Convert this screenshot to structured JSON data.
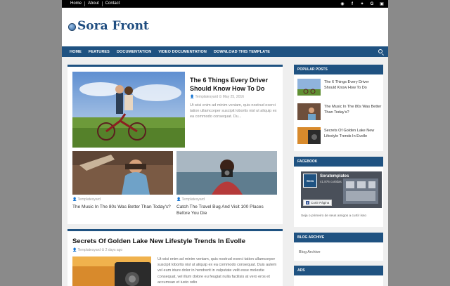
{
  "topbar": {
    "links": [
      "Home",
      "About",
      "Contact"
    ],
    "social_icons": [
      "rss-icon",
      "facebook-icon",
      "twitter-icon",
      "google-plus-icon",
      "instagram-icon"
    ]
  },
  "header": {
    "site_title": "Sora Front"
  },
  "nav": {
    "items": [
      "HOME",
      "FEATURES",
      "DOCUMENTATION",
      "VIDEO DOCUMENTATION",
      "DOWNLOAD THIS TEMPLATE"
    ]
  },
  "featured": {
    "title": "The 6 Things Every Driver Should Know How To Do",
    "author": "Templatesyard",
    "date": "May 25, 2016",
    "excerpt": "Ut wisi enim ad minim veniam, quis nostrud exerci tation ullamcorper suscipit lobortis nisl ut aliquip ex ea commodo consequat. Du..."
  },
  "small_posts": [
    {
      "author": "Templatesyard",
      "title": "The Music In The 80s Was Better Than Today's?"
    },
    {
      "author": "Templatesyard",
      "title": "Catch The Travel Bug And Visit 100 Places Before You Die"
    }
  ],
  "post2": {
    "title": "Secrets Of Golden Lake New Lifestyle Trends In Evolle",
    "author": "Templatesyard",
    "date": "2 days ago",
    "excerpt": "Ut wisi enim ad minim veniam, quis nostrud exerci tation ullamcorper suscipit lobortis nisl ut aliquip ex ea commodo consequat. Duis autem vel eum iriure dolor in hendrerit in vulputate velit esse molestie consequat, vel illum dolore eu feugiat nulla facilisis at vero eros et accumsan et iusto odio"
  },
  "sidebar": {
    "popular_title": "POPULAR POSTS",
    "popular": [
      "The 6 Things Every Driver Should Know How To Do",
      "The Music In The 80s Was Better Than Today's?",
      "Secrets Of Golden Lake New Lifestyle Trends In Evolle"
    ],
    "facebook_title": "FACEBOOK",
    "fb_page_name": "Soratemplates",
    "fb_likes": "41.876 curtidas",
    "fb_button": "Curtir Página",
    "fb_note": "Seja o primeiro de seus amigos a curtir isso",
    "archive_title": "BLOG ARCHIVE",
    "archive_label": "Blog Archive",
    "ads_title": "ADS"
  },
  "colors": {
    "brand": "#1f5281",
    "backdrop": "#8a8a8a"
  }
}
